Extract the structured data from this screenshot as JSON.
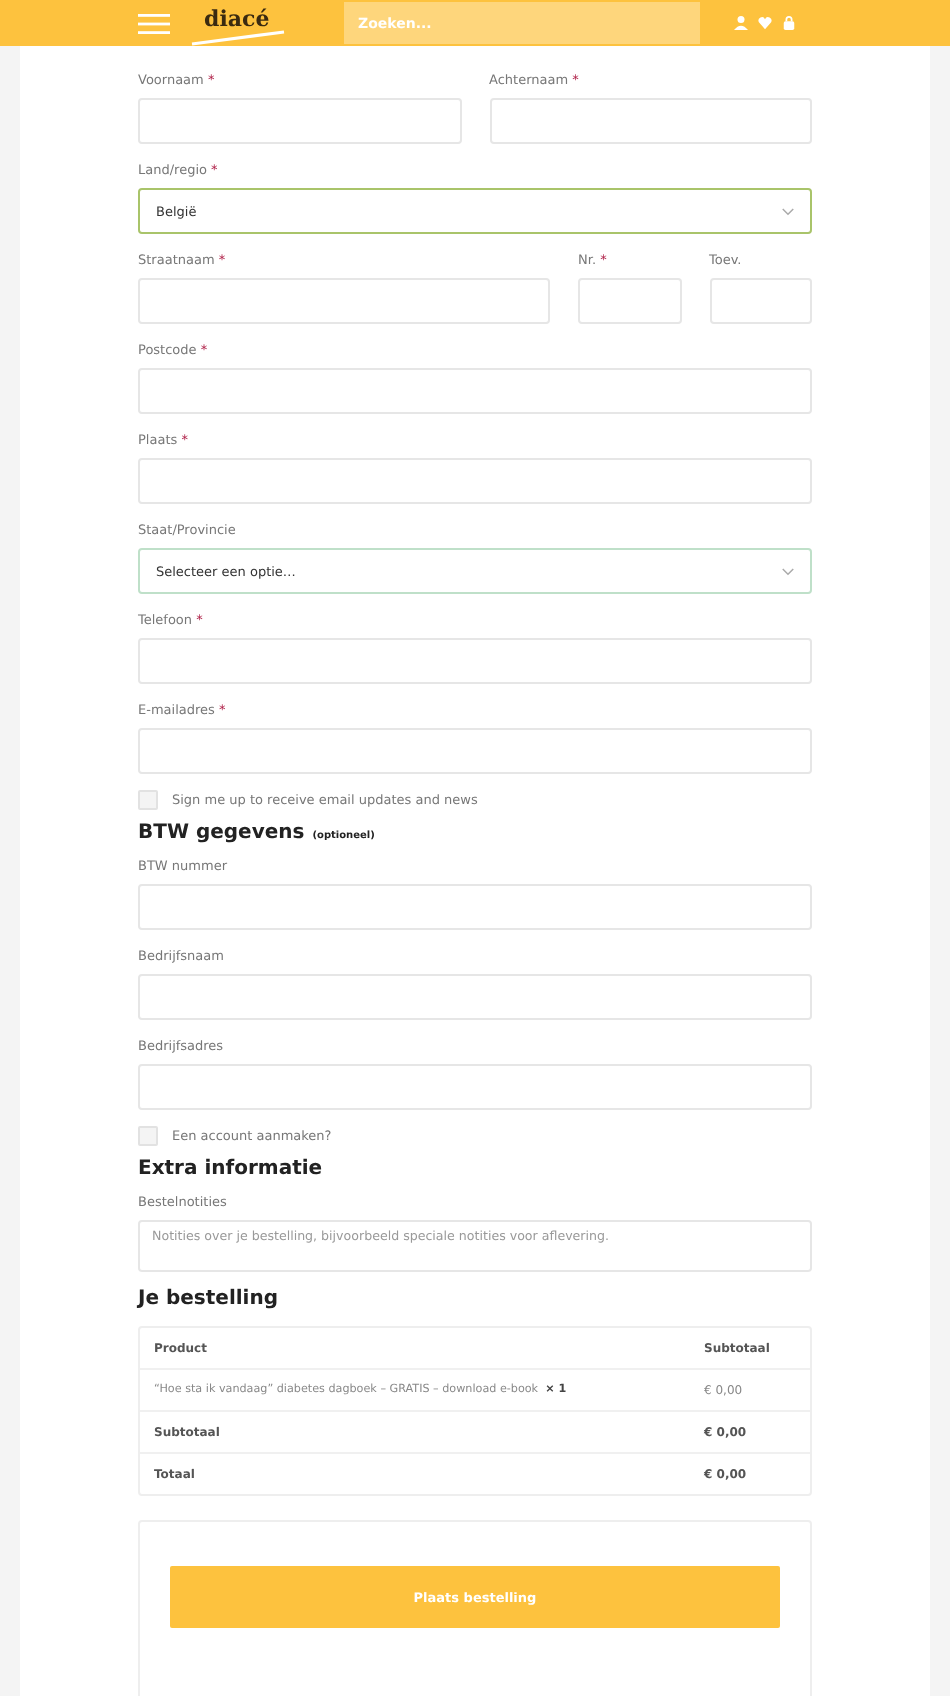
{
  "header": {
    "logo": "diacé",
    "search": {
      "placeholder": "Zoeken..."
    }
  },
  "form": [
    {
      "kind": "row",
      "fields": [
        {
          "label": "Voornaam",
          "required_mark": "*"
        },
        {
          "label": "Achternaam",
          "required_mark": "*"
        }
      ]
    },
    {
      "kind": "select",
      "label": "Land/regio",
      "required_mark": "*",
      "value": "België",
      "focused": true
    },
    {
      "kind": "row",
      "fields": [
        {
          "label": "Straatnaam",
          "required_mark": "*"
        },
        {
          "label": "Nr.",
          "required_mark": "*"
        },
        {
          "label": "Toev."
        }
      ]
    },
    {
      "kind": "text",
      "label": "Postcode",
      "required_mark": "*"
    },
    {
      "kind": "text",
      "label": "Plaats",
      "required_mark": "*"
    },
    {
      "kind": "select",
      "label": "Staat/Provincie",
      "value": "Selecteer een optie…",
      "focused": false
    },
    {
      "kind": "text",
      "label": "Telefoon",
      "required_mark": "*"
    },
    {
      "kind": "text",
      "label": "E-mailadres",
      "required_mark": "*"
    },
    {
      "kind": "checkbox",
      "label": "Sign me up to receive email updates and news",
      "checked": false
    },
    {
      "kind": "heading",
      "title": "BTW gegevens",
      "note": "(optioneel)"
    },
    {
      "kind": "text",
      "label": "BTW nummer"
    },
    {
      "kind": "text",
      "label": "Bedrijfsnaam"
    },
    {
      "kind": "text",
      "label": "Bedrijfsadres"
    },
    {
      "kind": "checkbox",
      "label": "Een account aanmaken?",
      "checked": false
    },
    {
      "kind": "heading",
      "title": "Extra informatie"
    },
    {
      "kind": "textarea",
      "label": "Bestelnotities",
      "placeholder": "Notities over je bestelling, bijvoorbeeld speciale notities voor aflevering."
    }
  ],
  "order": {
    "title": "Je bestelling",
    "columns": [
      "Product",
      "Subtotaal"
    ],
    "items": [
      {
        "name": "“Hoe sta ik vandaag” diabetes dagboek – GRATIS – download e-book",
        "quantity": "× 1",
        "price": "€ 0,00"
      }
    ],
    "totals": [
      {
        "label": "Subtotaal",
        "value": "€ 0,00"
      },
      {
        "label": "Totaal",
        "value": "€ 0,00"
      }
    ]
  },
  "place_order": "Plaats bestelling"
}
